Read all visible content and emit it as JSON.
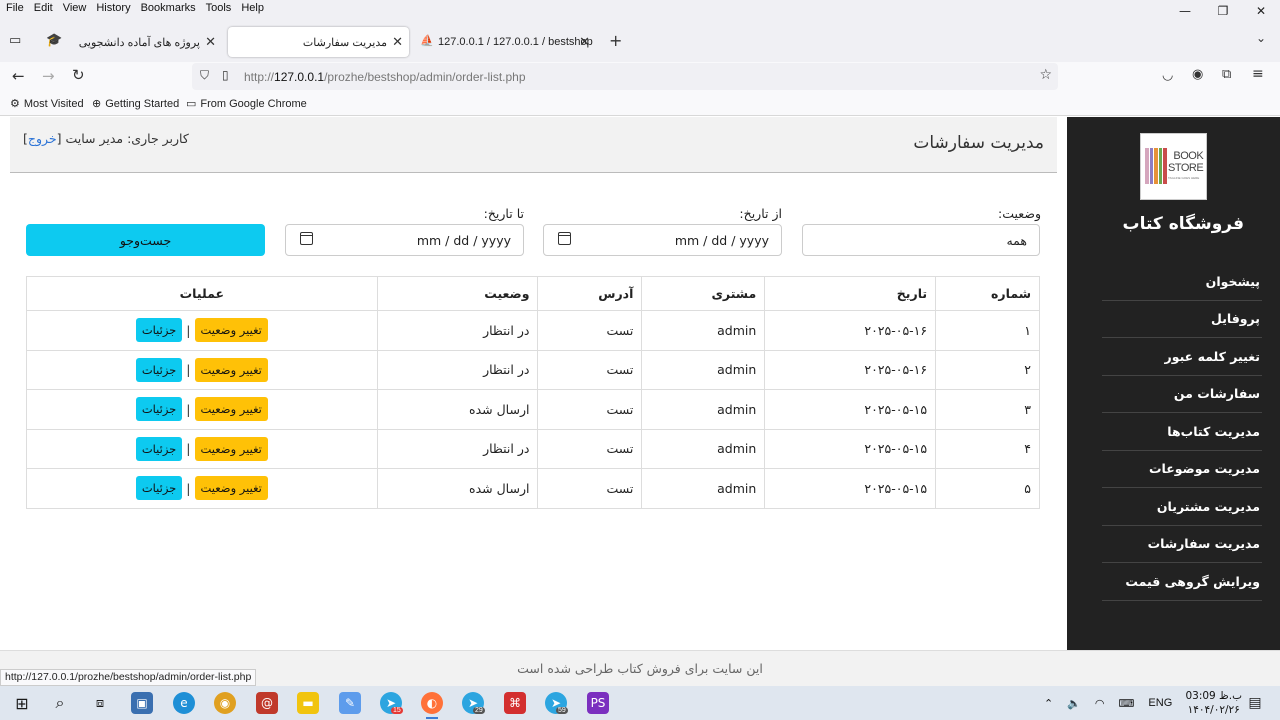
{
  "browser": {
    "menus": [
      "File",
      "Edit",
      "View",
      "History",
      "Bookmarks",
      "Tools",
      "Help"
    ],
    "tabs": [
      {
        "title": "پروژه های آماده دانشجویی",
        "close": "✕"
      },
      {
        "title": "مدیریت سفارشات",
        "close": "✕"
      },
      {
        "title": "127.0.0.1 / 127.0.0.1 / bestshop",
        "close": "✕"
      }
    ],
    "url_prefix": "http://",
    "url_host": "127.0.0.1",
    "url_path": "/prozhe/bestshop/admin/order-list.php",
    "bookmarks": [
      "Most Visited",
      "Getting Started",
      "From Google Chrome"
    ],
    "status_url": "http://127.0.0.1/prozhe/bestshop/admin/order-list.php"
  },
  "sidebar": {
    "logo_line1": "BOOK",
    "logo_line2": "STORE",
    "logo_tagline": "TAGLINE GOES HERE",
    "store_title": "فروشگاه کتاب",
    "items": [
      {
        "label": "پیشخوان"
      },
      {
        "label": "پروفایل"
      },
      {
        "label": "تغییر کلمه عبور"
      },
      {
        "label": "سفارشات من"
      },
      {
        "label": "مدیریت کتاب‌ها"
      },
      {
        "label": "مدیریت موضوعات"
      },
      {
        "label": "مدیریت مشتریان"
      },
      {
        "label": "مدیریت سفارشات"
      },
      {
        "label": "ویرایش گروهی قیمت"
      }
    ]
  },
  "header": {
    "page_title": "مدیریت سفارشات",
    "current_user_label": "کاربر جاری: مدیر سایت",
    "logout_label": "خروج"
  },
  "filters": {
    "status_label": "وضعیت:",
    "status_value": "همه",
    "from_label": "از تاریخ:",
    "from_placeholder": "mm / dd / yyyy",
    "to_label": "تا تاریخ:",
    "to_placeholder": "mm / dd / yyyy",
    "search_button": "جست‌وجو"
  },
  "table": {
    "headers": [
      "شماره",
      "تاریخ",
      "مشتری",
      "آدرس",
      "وضعیت",
      "عملیات"
    ],
    "change_status_label": "تغییر وضعیت",
    "details_label": "جزئیات",
    "separator": "|",
    "rows": [
      {
        "no": "۱",
        "date": "۲۰۲۵-۰۵-۱۶",
        "customer": "admin",
        "address": "تست",
        "status": "در انتظار"
      },
      {
        "no": "۲",
        "date": "۲۰۲۵-۰۵-۱۶",
        "customer": "admin",
        "address": "تست",
        "status": "در انتظار"
      },
      {
        "no": "۳",
        "date": "۲۰۲۵-۰۵-۱۵",
        "customer": "admin",
        "address": "تست",
        "status": "ارسال شده"
      },
      {
        "no": "۴",
        "date": "۲۰۲۵-۰۵-۱۵",
        "customer": "admin",
        "address": "تست",
        "status": "در انتظار"
      },
      {
        "no": "۵",
        "date": "۲۰۲۵-۰۵-۱۵",
        "customer": "admin",
        "address": "تست",
        "status": "ارسال شده"
      }
    ]
  },
  "footer": {
    "text": "این سایت برای فروش کتاب طراحی شده است"
  },
  "taskbar": {
    "language": "ENG",
    "time": "ب.ظ 03:09",
    "date": "۱۴۰۴/۰۲/۲۶",
    "badges": [
      "15",
      "29",
      "59"
    ]
  },
  "colors": {
    "sidebar_bg": "#222222",
    "accent_cyan": "#0dcaf0",
    "accent_yellow": "#ffc107",
    "link_blue": "#2a72d6"
  }
}
